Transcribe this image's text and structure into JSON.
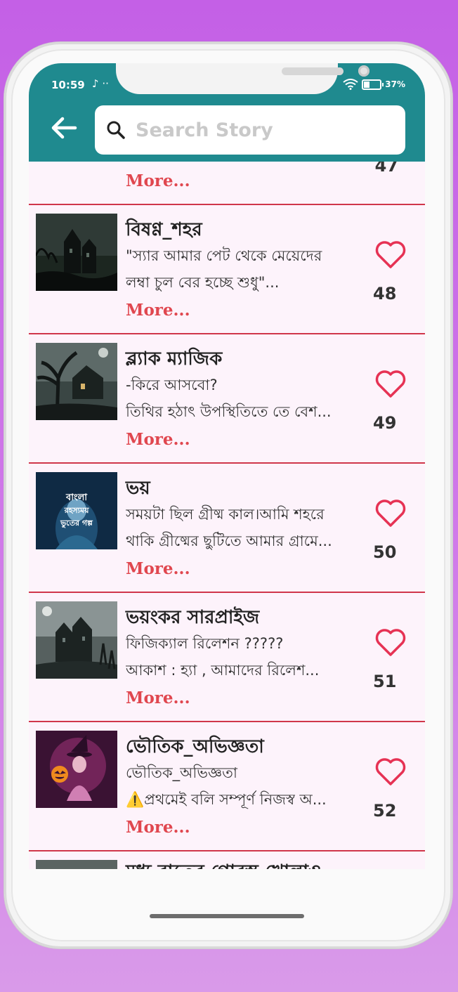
{
  "status_bar": {
    "time": "10:59",
    "extra": "♪ ··",
    "battery": "37%"
  },
  "search": {
    "placeholder": "Search Story"
  },
  "colors": {
    "appbar": "#1f8a8f",
    "accent": "#e0474f",
    "heart": "#e63254"
  },
  "icons": {
    "back": "arrow-left-icon",
    "search": "search-icon",
    "like": "heart-outline-icon"
  },
  "partial_top": {
    "more": "More...",
    "likes": "47"
  },
  "stories": [
    {
      "title": "বিষণ্ণ_শহর",
      "line1": "\"স্যার আমার পেট থেকে মেয়েদের",
      "line2": "লম্বা চুল বের হচ্ছে শুধু\"...",
      "more": "More...",
      "likes": "48"
    },
    {
      "title": "ব্ল্যাক ম্যাজিক",
      "line1": "-কিরে আসবো?",
      "line2": "তিথির হঠাৎ উপস্থিতিতে তে বেশ...",
      "more": "More...",
      "likes": "49"
    },
    {
      "title": "ভয়",
      "line1": "সময়টা ছিল গ্রীষ্ম কাল।আমি শহরে",
      "line2": "থাকি গ্রীষ্মের ছুটিতে আমার গ্রামে...",
      "more": "More...",
      "likes": "50",
      "thumb_text": "বাংলা রহস্যময় ভুতের গল্প"
    },
    {
      "title": "ভয়ংকর সারপ্রাইজ",
      "line1": "ফিজিক্যাল রিলেশন ?????",
      "line2": "আকাশ : হ্যা , আমাদের রিলেশ...",
      "more": "More...",
      "likes": "51"
    },
    {
      "title": "ভৌতিক_অভিজ্ঞতা",
      "line1": "ভৌতিক_অভিজ্ঞতা",
      "line2": "⚠️প্রথমেই বলি সম্পূর্ণ নিজস্ব অ...",
      "more": "More...",
      "likes": "52"
    }
  ],
  "peek": {
    "title": "মধ্য রাতের গোরস্ত খোলাও"
  }
}
